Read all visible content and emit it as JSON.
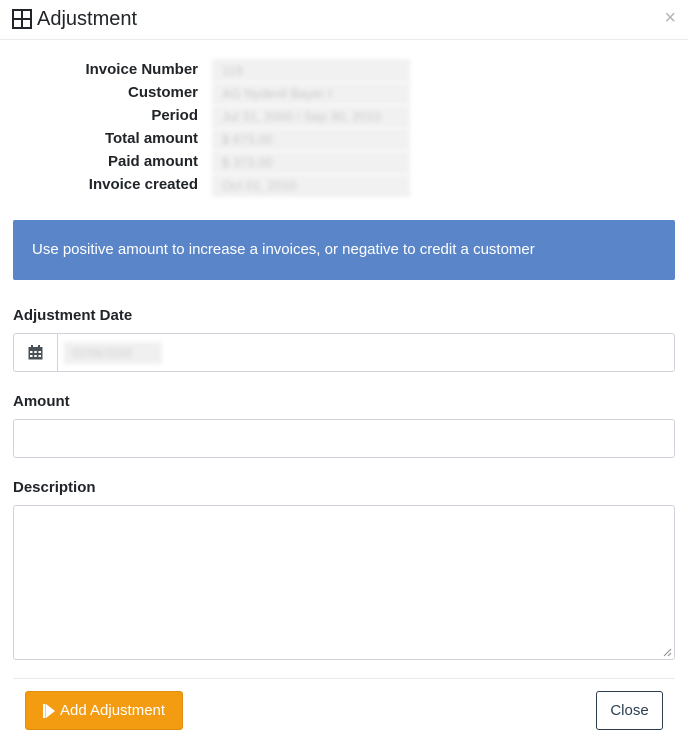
{
  "dialog": {
    "title": "Adjustment",
    "close_glyph": "×"
  },
  "invoice_info": [
    {
      "label": "Invoice Number",
      "value": "119"
    },
    {
      "label": "Customer",
      "value": "AG Nydevil Bayer I"
    },
    {
      "label": "Period",
      "value": "Jul 31, 2000 / Sep 30, 2010"
    },
    {
      "label": "Total amount",
      "value": "$ 673.00"
    },
    {
      "label": "Paid amount",
      "value": "$ 373.00"
    },
    {
      "label": "Invoice created",
      "value": "Oct 01, 2010"
    }
  ],
  "alert": {
    "text": "Use positive amount to increase a invoices, or negative to credit a customer"
  },
  "form": {
    "date_label": "Adjustment Date",
    "date_value": "02/06/2020",
    "amount_label": "Amount",
    "amount_value": "",
    "description_label": "Description",
    "description_value": ""
  },
  "buttons": {
    "add": "Add Adjustment",
    "close": "Close"
  },
  "colors": {
    "alert_bg": "#5a86c9",
    "primary_button": "#f39c12",
    "close_border": "#2c3e50"
  },
  "icons": {
    "title": "grid-icon",
    "date": "calendar-icon",
    "add": "step-forward-icon"
  }
}
